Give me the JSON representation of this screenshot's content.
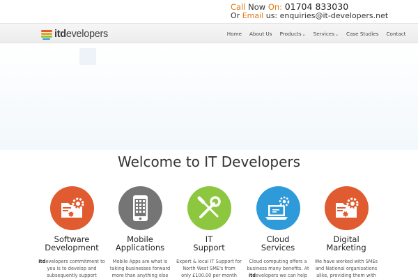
{
  "contact": {
    "call_word": "Call",
    "now_word": "Now",
    "on_word": "On:",
    "phone": "01704 833030",
    "or_word": "Or",
    "email_word": "Email",
    "us_word": "us:",
    "email": "enquiries@it-developers.net"
  },
  "brand": {
    "logo_prefix": "itd",
    "logo_suffix": "evelopers"
  },
  "nav": {
    "items": [
      "Home",
      "About Us",
      "Products",
      "Services",
      "Case Studies",
      "Contact"
    ]
  },
  "main": {
    "heading": "Welcome to IT Developers"
  },
  "services": [
    {
      "title_line1": "Software",
      "title_line2": "Development",
      "desc_bold": "itd",
      "desc_line1": "evelopers commitment to",
      "desc_line2": "you is to develop and",
      "desc_line3": "subsequently support",
      "icon": "folder-gear-icon",
      "color": "#e05b2f"
    },
    {
      "title_line1": "Mobile",
      "title_line2": "Applications",
      "desc_line1": "Mobile Apps are what is",
      "desc_line2": "taking businesses forward",
      "desc_line3": "more than anything else",
      "icon": "smartphone-icon",
      "color": "#757575"
    },
    {
      "title_line1": "IT",
      "title_line2": "Support",
      "desc_line1": "Expert & local IT Support for",
      "desc_line2": "North West SME's from",
      "desc_line3": "only £100.00 per month",
      "icon": "tools-icon",
      "color": "#8dc63f"
    },
    {
      "title_line1": "Cloud",
      "title_line2": "Services",
      "desc_line1": "Cloud computing offers a",
      "desc_line2": "business many benefits. At",
      "desc_bold": "itd",
      "desc_line3": "evelopers we can help",
      "icon": "cloud-laptop-icon",
      "color": "#2e9ad9"
    },
    {
      "title_line1": "Digital",
      "title_line2": "Marketing",
      "desc_line1": "We have worked with SMEs",
      "desc_line2": "and National organisations",
      "desc_line3": "alike, providing them with",
      "icon": "folder-gear-icon",
      "color": "#e05b2f"
    }
  ]
}
